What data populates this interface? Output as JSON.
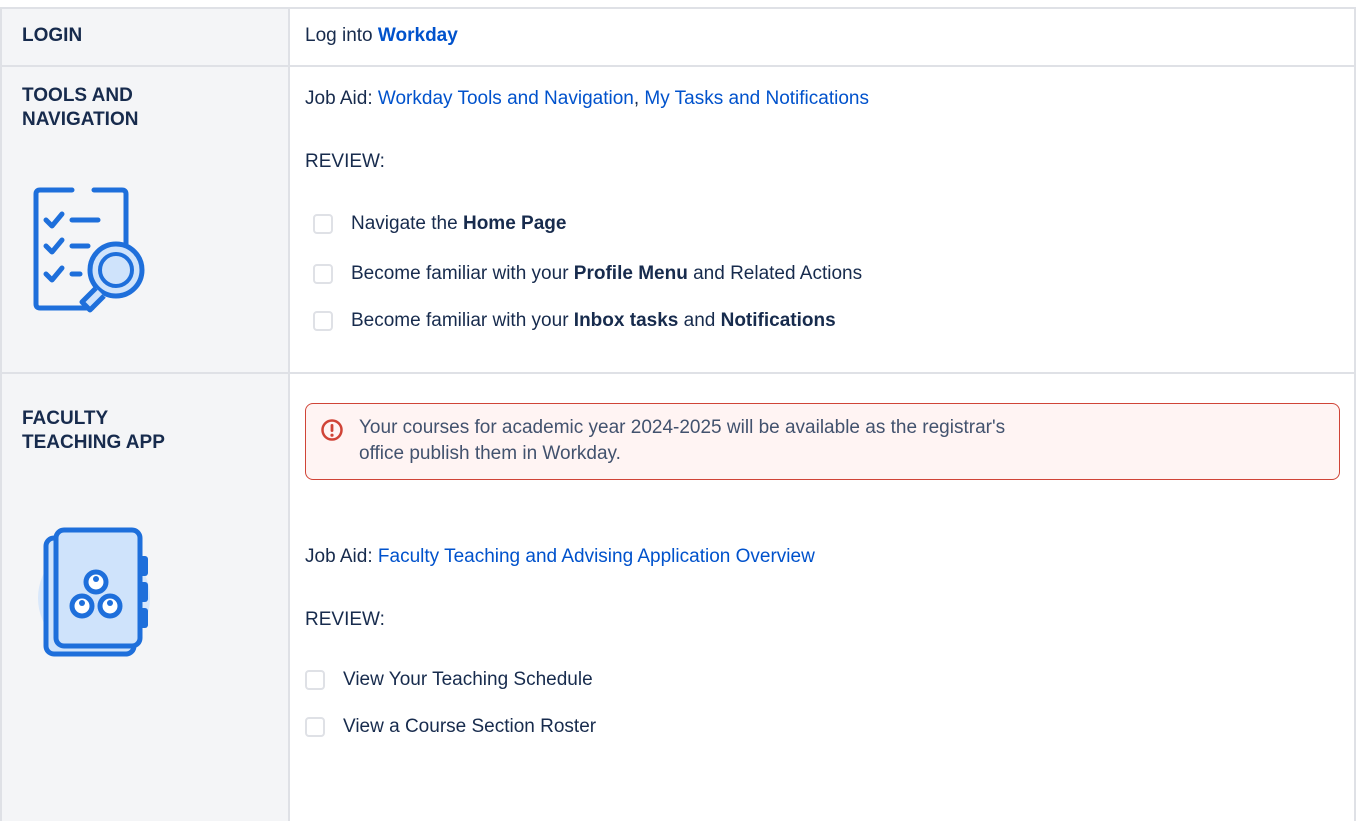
{
  "rows": {
    "login": {
      "header": "LOGIN",
      "text_prefix": "Log into ",
      "link": "Workday"
    },
    "tools": {
      "header_line1": "TOOLS AND",
      "header_line2": "NAVIGATION",
      "jobaid_prefix": "Job Aid: ",
      "jobaid_link1": "Workday Tools and Navigation",
      "jobaid_sep": ", ",
      "jobaid_link2": "My Tasks and Notifications",
      "review_label": "REVIEW:",
      "icon": "checklist-magnifier-icon",
      "tasks": [
        {
          "t1": "Navigate the ",
          "b1": "Home Page",
          "t2": "",
          "b2": "",
          "t3": ""
        },
        {
          "t1": "Become familiar with your ",
          "b1": "Profile Menu",
          "t2": " and Related Actions",
          "b2": "",
          "t3": ""
        },
        {
          "t1": "Become familiar with your ",
          "b1": "Inbox tasks",
          "t2": " and ",
          "b2": "Notifications",
          "t3": ""
        }
      ]
    },
    "faculty": {
      "header_line1": "FACULTY",
      "header_line2": "TEACHING APP",
      "icon": "address-book-icon",
      "warning_line1": "Your courses for academic year 2024-2025 will be available as the registrar's",
      "warning_line2": "office publish them in Workday.",
      "jobaid_prefix": "Job Aid: ",
      "jobaid_link": "Faculty Teaching and Advising Application Overview",
      "review_label": "REVIEW:",
      "tasks": [
        {
          "text": "View Your Teaching Schedule"
        },
        {
          "text": "View a Course Section Roster"
        }
      ]
    }
  },
  "colors": {
    "link": "#0052cc",
    "header_bg": "#f4f5f7",
    "border": "#dfe1e6",
    "warning_border": "#d04437",
    "warning_bg": "#fff4f3",
    "icon_blue": "#1e6fdb"
  }
}
